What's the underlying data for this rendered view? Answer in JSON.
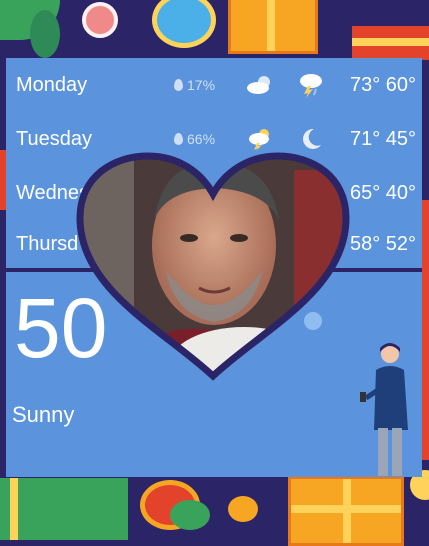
{
  "forecast": [
    {
      "day": "Monday",
      "precip": "17%",
      "icon1": "partly-cloudy-icon",
      "icon2": "thunderstorm-icon",
      "temps": "73° 60°"
    },
    {
      "day": "Tuesday",
      "precip": "66%",
      "icon1": "thunderstorm-sun-icon",
      "icon2": "moon-icon",
      "temps": "71° 45°"
    },
    {
      "day": "Wednes",
      "precip": "",
      "icon1": "",
      "icon2": "",
      "temps": "65° 40°"
    },
    {
      "day": "Thursd",
      "precip": "",
      "icon1": "",
      "icon2": "",
      "temps": "58° 52°"
    }
  ],
  "current": {
    "temperature": "50",
    "condition": "Sunny"
  },
  "colors": {
    "panel": "#5b93dc",
    "background": "#2b2466",
    "heart_border": "#2b2466"
  }
}
